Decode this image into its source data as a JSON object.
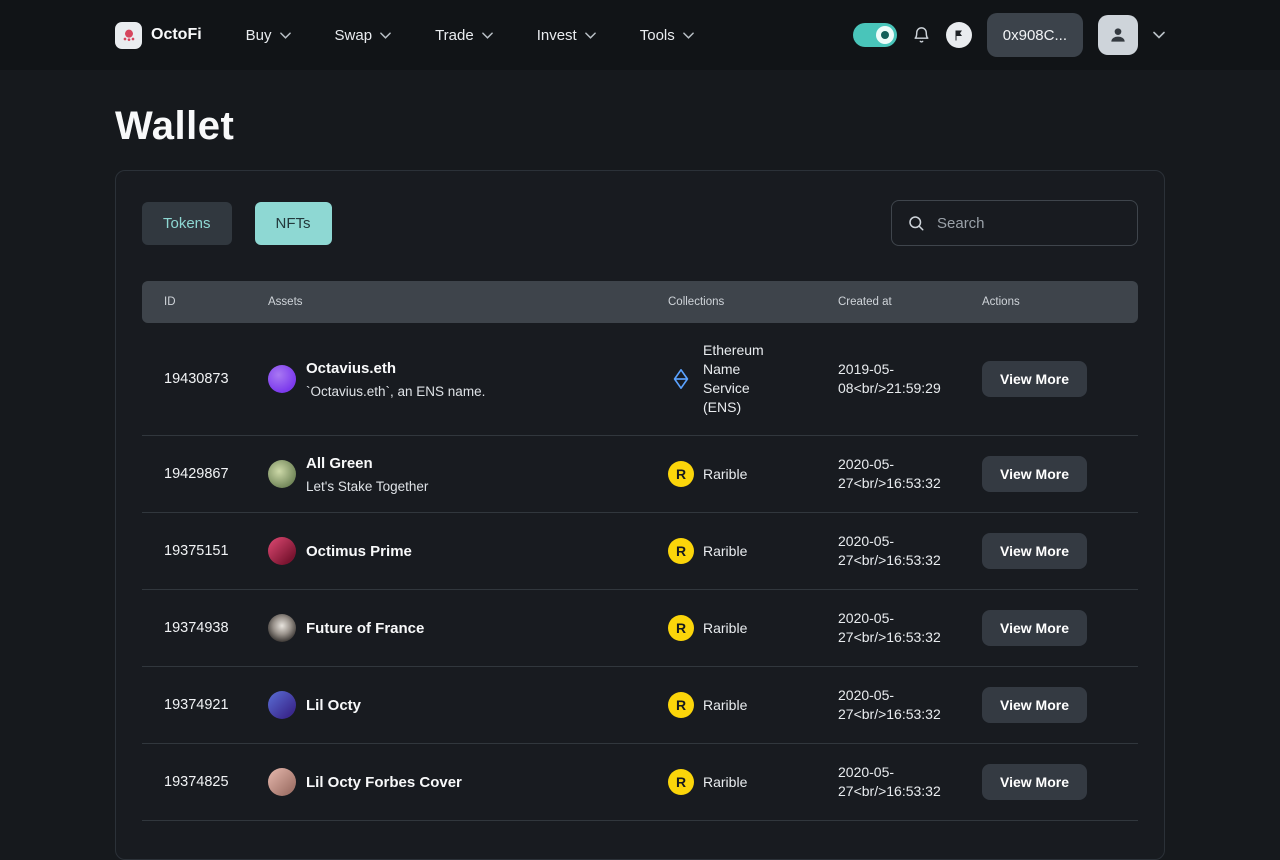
{
  "colors": {
    "accent": "#8ed8d3",
    "rarible_yellow": "#fbd50a",
    "ens_blue": "#5aa2ff"
  },
  "header": {
    "brand": "OctoFi",
    "nav": [
      {
        "label": "Buy"
      },
      {
        "label": "Swap"
      },
      {
        "label": "Trade"
      },
      {
        "label": "Invest"
      },
      {
        "label": "Tools"
      }
    ],
    "wallet_address": "0x908C..."
  },
  "page": {
    "title": "Wallet"
  },
  "tabs": {
    "tokens_label": "Tokens",
    "nfts_label": "NFTs"
  },
  "search": {
    "placeholder": "Search"
  },
  "table": {
    "headers": {
      "id": "ID",
      "assets": "Assets",
      "collections": "Collections",
      "created_at": "Created at",
      "actions": "Actions"
    },
    "action_label": "View More",
    "rarible_glyph": "R",
    "rows": [
      {
        "id": "19430873",
        "name": "Octavius.eth",
        "subtitle": "`Octavius.eth`, an ENS name.",
        "collection": "Ethereum Name Service (ENS)",
        "created": [
          "2019-05-",
          "08<br/>21:59:29"
        ]
      },
      {
        "id": "19429867",
        "name": "All Green",
        "subtitle": "Let's Stake Together",
        "collection": "Rarible",
        "created": [
          "2020-05-",
          "27<br/>16:53:32"
        ]
      },
      {
        "id": "19375151",
        "name": "Octimus Prime",
        "collection": "Rarible",
        "created": [
          "2020-05-",
          "27<br/>16:53:32"
        ]
      },
      {
        "id": "19374938",
        "name": "Future of France",
        "collection": "Rarible",
        "created": [
          "2020-05-",
          "27<br/>16:53:32"
        ]
      },
      {
        "id": "19374921",
        "name": "Lil Octy",
        "collection": "Rarible",
        "created": [
          "2020-05-",
          "27<br/>16:53:32"
        ]
      },
      {
        "id": "19374825",
        "name": "Lil Octy Forbes Cover",
        "collection": "Rarible",
        "created": [
          "2020-05-",
          "27<br/>16:53:32"
        ]
      }
    ]
  }
}
